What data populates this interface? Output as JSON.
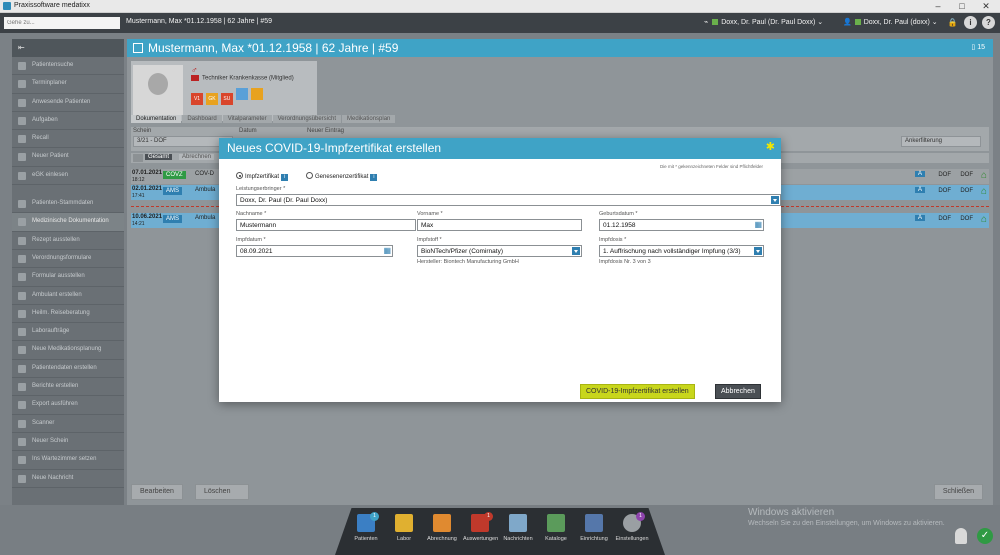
{
  "window": {
    "app_title": "Praxissoftware medatixx"
  },
  "topbar": {
    "search_placeholder": "Gehe zu...",
    "patient_context": "Mustermann, Max *01.12.1958 | 62 Jahre | #59",
    "doctor_filter": "Doxx, Dr. Paul (Dr. Paul Doxx)",
    "user": "Doxx, Dr. Paul (doxx)"
  },
  "sidebar": {
    "items": [
      {
        "label": "Patientensuche"
      },
      {
        "label": "Terminplaner"
      },
      {
        "label": "Anwesende Patienten"
      },
      {
        "label": "Aufgaben"
      },
      {
        "label": "Recall"
      },
      {
        "label": "Neuer Patient"
      },
      {
        "label": "eGK einlesen"
      },
      {
        "label": "Patienten-Stammdaten"
      },
      {
        "label": "Medizinische Dokumentation"
      },
      {
        "label": "Rezept ausstellen"
      },
      {
        "label": "Verordnungsformulare"
      },
      {
        "label": "Formular ausstellen"
      },
      {
        "label": "Ambulant erstellen"
      },
      {
        "label": "Heilm. Reiseberatung"
      },
      {
        "label": "Laboraufträge"
      },
      {
        "label": "Neue Medikationsplanung"
      },
      {
        "label": "Patientendaten erstellen"
      },
      {
        "label": "Berichte erstellen"
      },
      {
        "label": "Export ausführen"
      },
      {
        "label": "Scanner"
      },
      {
        "label": "Neuer Schein"
      },
      {
        "label": "Ins Wartezimmer setzen"
      },
      {
        "label": "Neue Nachricht"
      }
    ]
  },
  "patient": {
    "header": "Mustermann, Max *01.12.1958 | 62 Jahre | #59",
    "count": "15",
    "gender_symbol": "♂",
    "insurance": "Techniker Krankenkasse (Mitglied)",
    "flags": [
      {
        "text": "V1",
        "color": "#d9452b"
      },
      {
        "text": "GK",
        "color": "#e8a21f"
      },
      {
        "text": "SU",
        "color": "#d9452b"
      },
      {
        "text": "",
        "color": "#5aa0d8"
      },
      {
        "text": "",
        "color": "#e8a21f"
      }
    ]
  },
  "tabs": [
    "Dokumentation",
    "Dashboard",
    "Vitalparameter",
    "Verordnungsübersicht",
    "Medikationsplan"
  ],
  "filter": {
    "schein_label": "Schein",
    "schein_value": "3/21 - DOF",
    "datum_label": "Datum",
    "eintrag_label": "Neuer Eintrag",
    "right_value": "Ankerfilterung",
    "btn_gesamt": "Gesamt",
    "btn_abrechnung": "Abrechnen"
  },
  "rows": [
    {
      "date": "07.01.2021",
      "sub": "18:12",
      "tag": "COVZ",
      "tag_color": "#2f9a44",
      "text": "COV-D",
      "r1": "A",
      "r2": "DOF",
      "r3": "DOF"
    },
    {
      "date": "02.01.2021",
      "sub": "17:41",
      "tag": "AMS",
      "tag_color": "#2f7fb0",
      "text": "Ambula",
      "r1": "A",
      "r2": "DOF",
      "r3": "DOF"
    },
    {
      "date": "10.06.2021",
      "sub": "14:21",
      "tag": "AMS",
      "tag_color": "#2f7fb0",
      "text": "Ambula",
      "r1": "A",
      "r2": "DOF",
      "r3": "DOF"
    }
  ],
  "bottom_buttons": {
    "edit": "Bearbeiten",
    "delete": "Löschen",
    "close": "Schließen"
  },
  "modal": {
    "title": "Neues COVID-19-Impfzertifikat erstellen",
    "hint": "Die mit * gekennzeichneten Felder sind Pflichtfelder",
    "radio_vaccination": "Impfzertifikat",
    "radio_recovery": "Genesenenzertifikat",
    "provider_label": "Leistungserbringer *",
    "provider_value": "Doxx, Dr. Paul (Dr. Paul Doxx)",
    "lastname_label": "Nachname *",
    "lastname_value": "Mustermann",
    "firstname_label": "Vorname *",
    "firstname_value": "Max",
    "birthdate_label": "Geburtsdatum *",
    "birthdate_value": "01.12.1958",
    "vaccdate_label": "Impfdatum *",
    "vaccdate_value": "08.09.2021",
    "vaccine_label": "Impfstoff *",
    "vaccine_value": "BioNTech/Pfizer (Comirnaty)",
    "manufacturer_text": "Hersteller: Biontech Manufacturing GmbH",
    "dose_label": "Impfdosis *",
    "dose_value": "1. Auffrischung nach vollständiger Impfung (3/3)",
    "dose_text": "Impfdosis Nr. 3 von 3",
    "btn_create": "COVID-19-Impfzertifikat erstellen",
    "btn_cancel": "Abbrechen"
  },
  "dock": [
    {
      "label": "Patienten",
      "color": "#3b7fc4",
      "badge": "1",
      "badge_color": "#3fa3c6"
    },
    {
      "label": "Labor",
      "color": "#e0b030",
      "badge": "",
      "badge_color": ""
    },
    {
      "label": "Abrechnung",
      "color": "#e08a30",
      "badge": "",
      "badge_color": ""
    },
    {
      "label": "Auswertungen",
      "color": "#c0392b",
      "badge": "1",
      "badge_color": "#c0392b"
    },
    {
      "label": "Nachrichten",
      "color": "#7fa8c9",
      "badge": "",
      "badge_color": ""
    },
    {
      "label": "Kataloge",
      "color": "#5b9b5b",
      "badge": "",
      "badge_color": ""
    },
    {
      "label": "Einrichtung",
      "color": "#5577aa",
      "badge": "",
      "badge_color": ""
    },
    {
      "label": "Einstellungen",
      "color": "#9a9fa3",
      "badge": "1",
      "badge_color": "#8e44ad"
    }
  ],
  "watermark": {
    "title": "Windows aktivieren",
    "subtitle": "Wechseln Sie zu den Einstellungen, um Windows zu aktivieren."
  }
}
